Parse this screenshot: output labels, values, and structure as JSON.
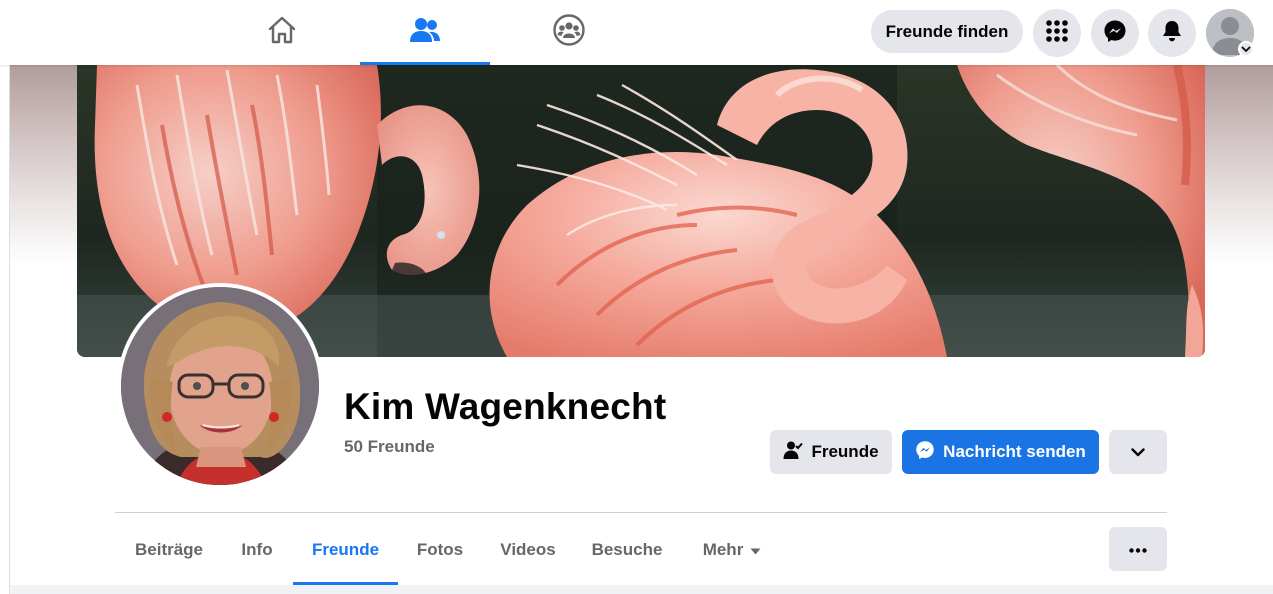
{
  "topbar": {
    "tabs": [
      {
        "icon": "home-icon",
        "active": false
      },
      {
        "icon": "friends-icon",
        "active": true
      },
      {
        "icon": "groups-icon",
        "active": false
      }
    ],
    "find_friends_label": "Freunde finden",
    "icons": [
      "menu-grid-icon",
      "messenger-icon",
      "notifications-bell-icon",
      "account-avatar-icon"
    ]
  },
  "profile": {
    "name": "Kim Wagenknecht",
    "friend_count": "50 Freunde",
    "friends_button": "Freunde",
    "message_button": "Nachricht senden"
  },
  "profile_tabs": [
    {
      "label": "Beiträge",
      "active": false
    },
    {
      "label": "Info",
      "active": false
    },
    {
      "label": "Freunde",
      "active": true
    },
    {
      "label": "Fotos",
      "active": false
    },
    {
      "label": "Videos",
      "active": false
    },
    {
      "label": "Besuche",
      "active": false
    },
    {
      "label": "Mehr",
      "active": false
    }
  ],
  "colors": {
    "accent": "#1877f2",
    "button_gray": "#e4e6eb",
    "secondary_text": "#65676b"
  }
}
